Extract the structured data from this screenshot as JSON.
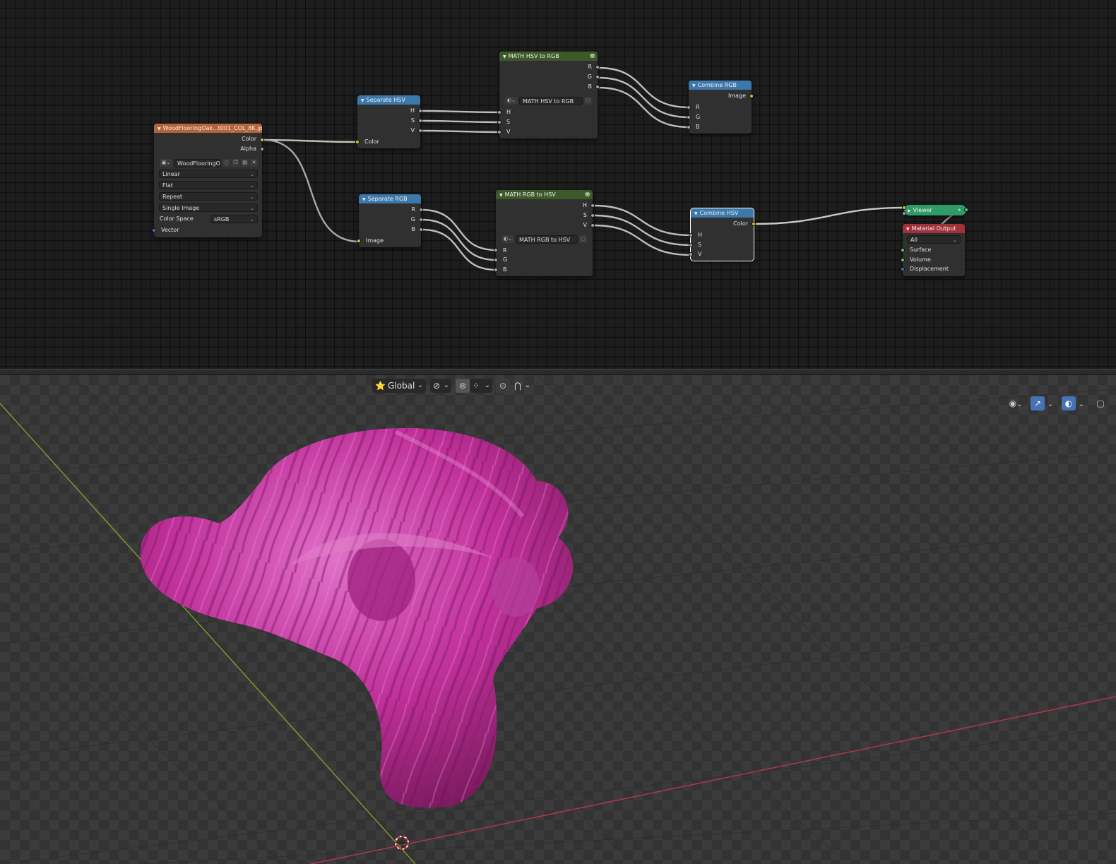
{
  "node_editor": {
    "image_node": {
      "title": "WoodFlooringOak...t001_COL_8K.jpg",
      "out_color": "Color",
      "out_alpha": "Alpha",
      "image_name": "WoodFlooringO...",
      "interpolation": "Linear",
      "projection": "Flat",
      "extension": "Repeat",
      "source": "Single Image",
      "color_space_label": "Color Space",
      "color_space_value": "sRGB",
      "in_vector": "Vector"
    },
    "separate_hsv": {
      "title": "Separate HSV",
      "out_h": "H",
      "out_s": "S",
      "out_v": "V",
      "in_color": "Color"
    },
    "math_hsv_to_rgb": {
      "title": "MATH HSV to RGB",
      "out_r": "R",
      "out_g": "G",
      "out_b": "B",
      "group_name": "MATH HSV to RGB",
      "in_h": "H",
      "in_s": "S",
      "in_v": "V"
    },
    "combine_rgb": {
      "title": "Combine RGB",
      "out_image": "Image",
      "in_r": "R",
      "in_g": "G",
      "in_b": "B"
    },
    "separate_rgb": {
      "title": "Separate RGB",
      "out_r": "R",
      "out_g": "G",
      "out_b": "B",
      "in_image": "Image"
    },
    "math_rgb_to_hsv": {
      "title": "MATH RGB to HSV",
      "out_h": "H",
      "out_s": "S",
      "out_v": "V",
      "group_name": "MATH RGB to HSV",
      "in_r": "R",
      "in_g": "G",
      "in_b": "B"
    },
    "combine_hsv": {
      "title": "Combine HSV",
      "out_color": "Color",
      "in_h": "H",
      "in_s": "S",
      "in_v": "V"
    },
    "viewer": {
      "title": "Viewer"
    },
    "material_output": {
      "title": "Material Output",
      "target": "All",
      "in_surface": "Surface",
      "in_volume": "Volume",
      "in_displacement": "Displacement"
    }
  },
  "viewport_header": {
    "orientation": "Global",
    "icons": [
      "orientation-icon",
      "pivot-icon",
      "snap-icon",
      "snap-grid-icon",
      "proportional-icon",
      "falloff-icon"
    ]
  },
  "viewport_overlay_icons": [
    "visibility-icon",
    "gizmo-icon",
    "overlay-icon",
    "xray-icon"
  ],
  "colors": {
    "socket_grey": "#a1a1a1",
    "socket_yellow": "#c7c729",
    "socket_purple": "#6363c7",
    "socket_green": "#63c763",
    "x_axis": "#b0374a",
    "y_axis": "#7a9a2a",
    "mesh": "#c0309a",
    "active": "#4772b3"
  }
}
